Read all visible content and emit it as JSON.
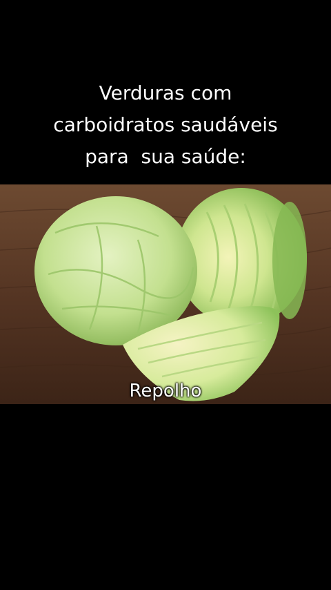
{
  "caption": {
    "line1": "Verduras com",
    "line2": "carboidratos saudáveis",
    "line3": "para  sua saúde:"
  },
  "photo": {
    "subject_label": "Repolho",
    "colors": {
      "background": "#000000",
      "wood": "#5a3a24",
      "cabbage_light": "#d9ecb0",
      "cabbage_dark": "#8fc25a"
    }
  }
}
